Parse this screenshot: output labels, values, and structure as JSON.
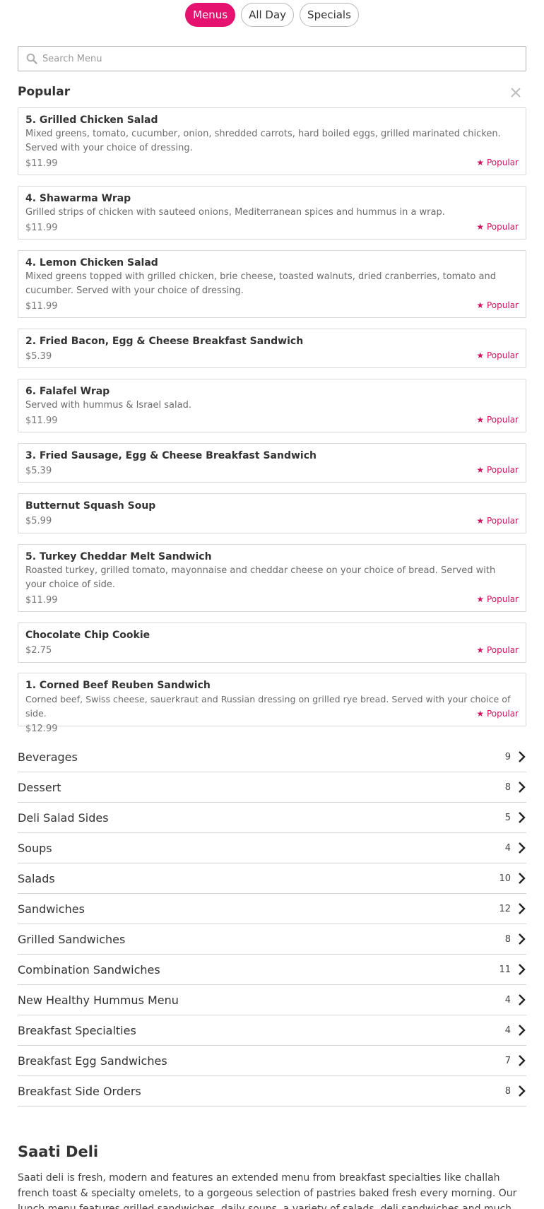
{
  "tabs": [
    {
      "label": "Menus",
      "active": true
    },
    {
      "label": "All Day",
      "active": false
    },
    {
      "label": "Specials",
      "active": false
    }
  ],
  "search": {
    "placeholder": "Search Menu",
    "icon": "search-icon"
  },
  "popular": {
    "title": "Popular",
    "close_icon": "close-icon",
    "badge_color": "#d3105f",
    "items": [
      {
        "name": "5. Grilled Chicken Salad",
        "description": "Mixed greens, tomato, cucumber, onion, shredded carrots, hard boiled eggs, grilled marinated chicken. Served with your choice of dressing.",
        "price": "$11.99",
        "badge": "★ Popular"
      },
      {
        "name": "4. Shawarma Wrap",
        "description": "Grilled strips of chicken with sauteed onions, Mediterranean spices and hummus in a wrap.",
        "price": "$11.99",
        "badge": "★ Popular"
      },
      {
        "name": "4. Lemon Chicken Salad",
        "description": "Mixed greens topped with grilled chicken, brie cheese, toasted walnuts, dried cranberries, tomato and cucumber. Served with your choice of dressing.",
        "price": "$11.99",
        "badge": "★ Popular"
      },
      {
        "name": "2. Fried Bacon, Egg & Cheese Breakfast Sandwich",
        "description": "",
        "price": "$5.39",
        "badge": "★ Popular"
      },
      {
        "name": "6. Falafel Wrap",
        "description": "Served with hummus & Israel salad.",
        "price": "$11.99",
        "badge": "★ Popular"
      },
      {
        "name": "3. Fried Sausage, Egg & Cheese Breakfast Sandwich",
        "description": "",
        "price": "$5.39",
        "badge": "★ Popular"
      },
      {
        "name": "Butternut Squash Soup",
        "description": "",
        "price": "$5.99",
        "badge": "★ Popular"
      },
      {
        "name": "5. Turkey Cheddar Melt Sandwich",
        "description": "Roasted turkey, grilled tomato, mayonnaise and cheddar cheese on your choice of bread. Served with your choice of side.",
        "price": "$11.99",
        "badge": "★ Popular"
      },
      {
        "name": "Chocolate Chip Cookie",
        "description": "",
        "price": "$2.75",
        "badge": "★ Popular"
      },
      {
        "name": "1. Corned Beef Reuben Sandwich",
        "description": "Corned beef, Swiss cheese, sauerkraut and Russian dressing on grilled rye bread. Served with your choice of side.",
        "price": "$12.99",
        "badge": "★ Popular"
      }
    ]
  },
  "categories": [
    {
      "name": "Beverages",
      "count": "9"
    },
    {
      "name": "Dessert",
      "count": "8"
    },
    {
      "name": "Deli Salad Sides",
      "count": "5"
    },
    {
      "name": "Soups",
      "count": "4"
    },
    {
      "name": "Salads",
      "count": "10"
    },
    {
      "name": "Sandwiches",
      "count": "12"
    },
    {
      "name": "Grilled Sandwiches",
      "count": "8"
    },
    {
      "name": "Combination Sandwiches",
      "count": "11"
    },
    {
      "name": "New Healthy Hummus Menu",
      "count": "4"
    },
    {
      "name": "Breakfast Specialties",
      "count": "4"
    },
    {
      "name": "Breakfast Egg Sandwiches",
      "count": "7"
    },
    {
      "name": "Breakfast Side Orders",
      "count": "8"
    }
  ],
  "about": {
    "title": "Saati Deli",
    "text": "Saati deli is fresh, modern and features an extended menu from breakfast specialties like challah french toast & specialty omelets, to a gorgeous selection of pastries baked fresh every morning. Our lunch menu features grilled sandwiches, daily soups, a variety of salads, deli sandwiches and much more."
  },
  "colors": {
    "accent": "#e5126f",
    "badge": "#d3105f"
  }
}
